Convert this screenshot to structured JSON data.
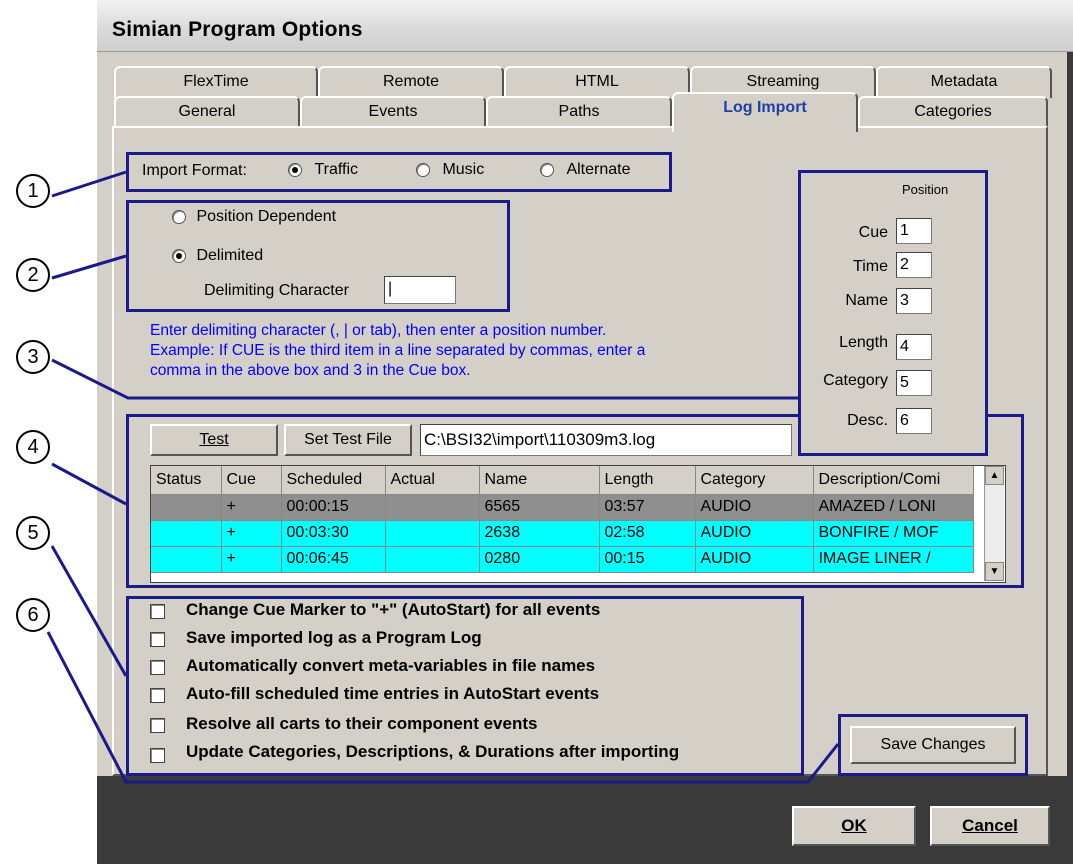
{
  "window": {
    "title": "Simian Program Options"
  },
  "tabs_row1": [
    "FlexTime",
    "Remote",
    "HTML",
    "Streaming",
    "Metadata"
  ],
  "tabs_row2": [
    "General",
    "Events",
    "Paths",
    "Log Import",
    "Categories"
  ],
  "import_format": {
    "label": "Import Format:",
    "options": [
      "Traffic",
      "Music",
      "Alternate"
    ],
    "selected": "Traffic"
  },
  "mode": {
    "position_dependent": "Position Dependent",
    "delimited": "Delimited",
    "selected": "Delimited",
    "delim_label": "Delimiting Character",
    "delim_value": "|"
  },
  "help_text": {
    "line1": "Enter delimiting character (, | or tab), then enter a position number.",
    "line2": "Example: If CUE is the third item in a line separated by commas, enter a",
    "line3": "comma in the above box and 3 in the Cue box."
  },
  "position": {
    "header": "Position",
    "fields": [
      {
        "label": "Cue",
        "value": "1"
      },
      {
        "label": "Time",
        "value": "2"
      },
      {
        "label": "Name",
        "value": "3"
      },
      {
        "label": "Length",
        "value": "4"
      },
      {
        "label": "Category",
        "value": "5"
      },
      {
        "label": "Desc.",
        "value": "6"
      }
    ]
  },
  "test": {
    "test_button": "Test",
    "set_test_file_button": "Set Test File",
    "file_path": "C:\\BSI32\\import\\110309m3.log"
  },
  "grid": {
    "columns": [
      "Status",
      "Cue",
      "Scheduled",
      "Actual",
      "Name",
      "Length",
      "Category",
      "Description/Comi"
    ],
    "rows": [
      [
        "",
        "+",
        "00:00:15",
        "",
        "6565",
        "03:57",
        "AUDIO",
        "AMAZED / LONI"
      ],
      [
        "",
        "+",
        "00:03:30",
        "",
        "2638",
        "02:58",
        "AUDIO",
        "BONFIRE / MOF"
      ],
      [
        "",
        "+",
        "00:06:45",
        "",
        "0280",
        "00:15",
        "AUDIO",
        "IMAGE LINER /"
      ]
    ]
  },
  "options": [
    "Change Cue Marker to \"+\" (AutoStart) for all events",
    "Save imported log as a Program Log",
    "Automatically convert meta-variables in file names",
    "Auto-fill scheduled time entries in AutoStart events",
    "Resolve all carts to their component events",
    "Update Categories, Descriptions, & Durations after importing"
  ],
  "buttons": {
    "save_changes": "Save Changes",
    "ok": "OK",
    "cancel": "Cancel"
  },
  "callouts": [
    "1",
    "2",
    "3",
    "4",
    "5",
    "6"
  ],
  "colors": {
    "callout_box": "#1a1a8a",
    "help_text": "#0000ff",
    "grid_highlight": "#00ffff",
    "active_tab": "#1f3fa8"
  }
}
